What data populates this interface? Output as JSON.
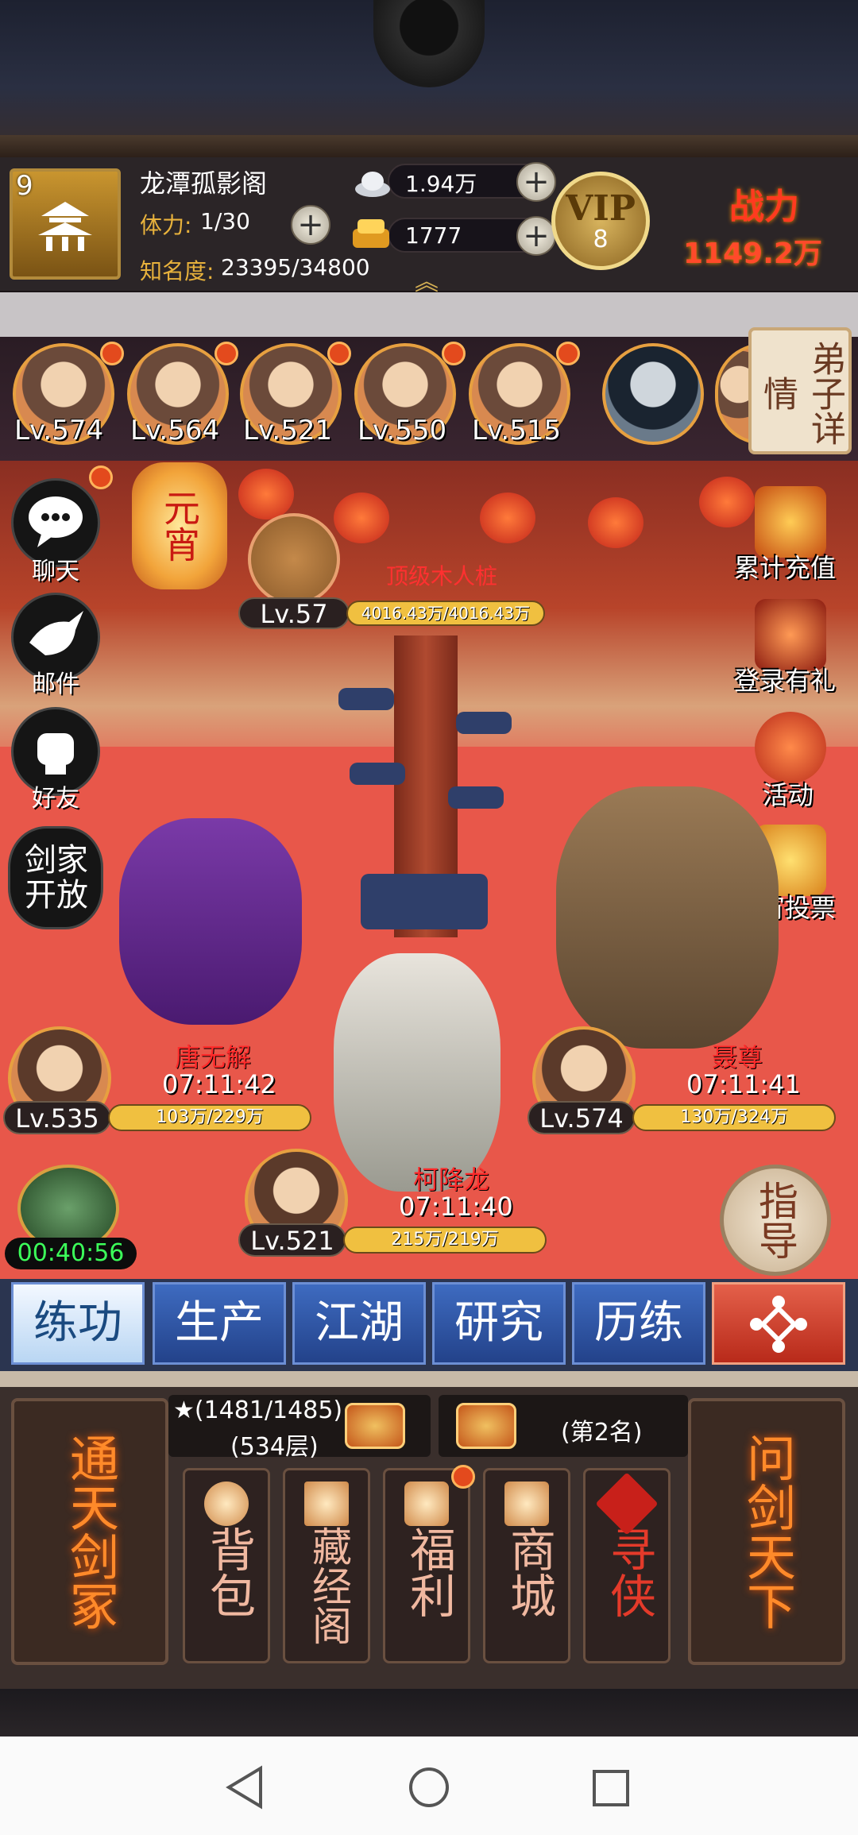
{
  "player": {
    "level": "9",
    "name": "龙潭孤影阁",
    "stamina_label": "体力:",
    "stamina_value": "1/30",
    "fame_label": "知名度:",
    "fame_value": "23395/34800"
  },
  "resources": {
    "silver": "1.94万",
    "gold": "1777"
  },
  "vip": {
    "text": "VIP",
    "level": "8"
  },
  "power": {
    "label": "战力",
    "value": "1149.2万"
  },
  "disciples": [
    {
      "level": "Lv.574",
      "badge": true
    },
    {
      "level": "Lv.564",
      "badge": true
    },
    {
      "level": "Lv.521",
      "badge": true
    },
    {
      "level": "Lv.550",
      "badge": true
    },
    {
      "level": "Lv.515",
      "badge": true
    },
    {
      "level": "",
      "badge": false
    }
  ],
  "disciple_detail_label": "弟子详情",
  "left_menu": [
    {
      "label": "聊天",
      "icon": "chat-icon"
    },
    {
      "label": "邮件",
      "icon": "dove-icon"
    },
    {
      "label": "好友",
      "icon": "fist-icon"
    },
    {
      "label": "剑家开放",
      "icon": "sword-house-icon"
    }
  ],
  "event_lantern": "元宵",
  "right_menu": [
    {
      "label": "累计充值",
      "icon": "gold-ingot-icon"
    },
    {
      "label": "登录有礼",
      "icon": "treasure-chest-icon"
    },
    {
      "label": "活动",
      "icon": "lantern-icon"
    },
    {
      "label": "元宵投票",
      "icon": "vote-box-icon"
    }
  ],
  "training_dummy": {
    "name": "顶级木人桩",
    "level": "Lv.57",
    "hp": "4016.43万/4016.43万"
  },
  "fighters": [
    {
      "name": "唐无解",
      "timer": "07:11:42",
      "level": "Lv.535",
      "hp": "103万/229万"
    },
    {
      "name": "聂尊",
      "timer": "07:11:41",
      "level": "Lv.574",
      "hp": "130万/324万"
    },
    {
      "name": "柯降龙",
      "timer": "07:11:40",
      "level": "Lv.521",
      "hp": "215万/219万"
    }
  ],
  "building_timer": "00:40:56",
  "guide_label": "指导",
  "tabs": [
    {
      "label": "练功",
      "active": true
    },
    {
      "label": "生产",
      "active": false
    },
    {
      "label": "江湖",
      "active": false
    },
    {
      "label": "研究",
      "active": false
    },
    {
      "label": "历练",
      "active": false
    }
  ],
  "tower": {
    "progress": "★(1481/1485)",
    "floor": "(534层)"
  },
  "rank": "(第2名)",
  "big_cards": {
    "left": "通天剑冢",
    "right": "问剑天下"
  },
  "menu_cards": [
    {
      "label": "背包",
      "icon": "peach-icon",
      "badge": false
    },
    {
      "label": "藏经阁",
      "icon": "pavilion-icon",
      "badge": false
    },
    {
      "label": "福利",
      "icon": "coin-icon",
      "badge": true
    },
    {
      "label": "商城",
      "icon": "shop-icon",
      "badge": false
    },
    {
      "label": "寻侠",
      "icon": "seal-icon",
      "badge": false
    }
  ],
  "colors": {
    "accent_gold": "#e8b23c",
    "power_red": "#ff3a1f",
    "tab_blue": "#23428a",
    "timer_green": "#3cff5a"
  }
}
